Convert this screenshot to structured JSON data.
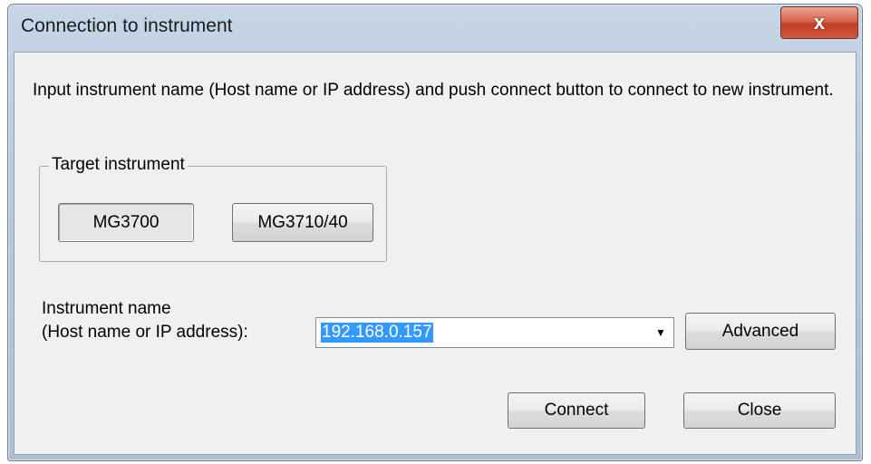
{
  "window": {
    "title": "Connection to instrument",
    "close_glyph": "x"
  },
  "instructions": "Input instrument name (Host name or IP address) and push connect button to connect to new instrument.",
  "target_group": {
    "legend": "Target instrument",
    "buttons": [
      {
        "label": "MG3700",
        "pressed": true
      },
      {
        "label": "MG3710/40",
        "pressed": false
      }
    ]
  },
  "instrument": {
    "label_line1": "Instrument name",
    "label_line2": "(Host name or IP address):",
    "value": "192.168.0.157",
    "dropdown_glyph": "▼"
  },
  "buttons": {
    "advanced": "Advanced",
    "connect": "Connect",
    "close": "Close"
  },
  "icons": {
    "close": "close-icon",
    "dropdown": "chevron-down-icon"
  },
  "colors": {
    "selection": "#3399ff",
    "close_button": "#c23c24",
    "dialog_bg": "#f0f0f0"
  }
}
